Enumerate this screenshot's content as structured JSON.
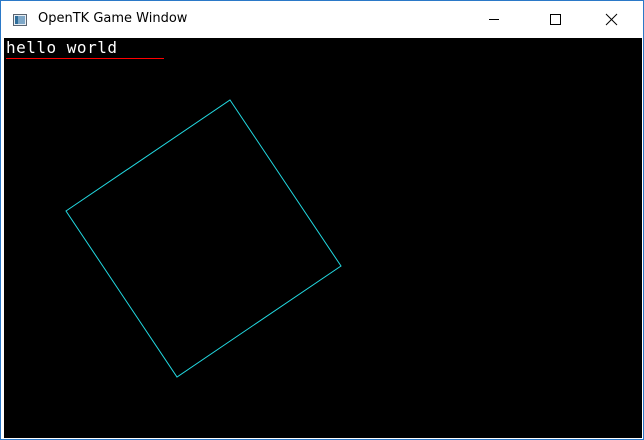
{
  "window": {
    "title": "OpenTK Game Window",
    "icon": "app-window-icon",
    "controls": {
      "minimize_icon": "minimize-icon",
      "maximize_icon": "maximize-icon",
      "close_icon": "close-icon"
    }
  },
  "viewport": {
    "background": "#000000",
    "hud_text": "hello world",
    "hud_text_color": "#ffffff",
    "hud_underline_color": "#ff0000",
    "shape": {
      "type": "square",
      "outline_color": "#22d8e0"
    }
  }
}
